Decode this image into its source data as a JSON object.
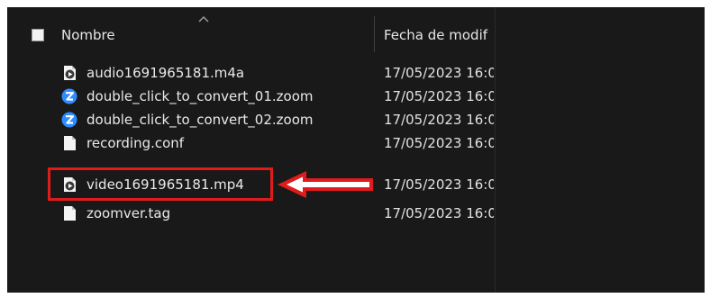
{
  "header": {
    "name_label": "Nombre",
    "date_label": "Fecha de modif",
    "sort_icon": "chevron-up-icon"
  },
  "files": [
    {
      "name": "audio1691965181.m4a",
      "date": "17/05/2023 16:0",
      "icon": "media-file-icon",
      "selected": false
    },
    {
      "name": "double_click_to_convert_01.zoom",
      "date": "17/05/2023 16:0",
      "icon": "zoom-file-icon",
      "selected": false
    },
    {
      "name": "double_click_to_convert_02.zoom",
      "date": "17/05/2023 16:0",
      "icon": "zoom-file-icon",
      "selected": false
    },
    {
      "name": "recording.conf",
      "date": "17/05/2023 16:0",
      "icon": "document-icon",
      "selected": false
    },
    {
      "name": "video1691965181.mp4",
      "date": "17/05/2023 16:0",
      "icon": "media-file-icon",
      "selected": false
    },
    {
      "name": "zoomver.tag",
      "date": "17/05/2023 16:0",
      "icon": "document-icon",
      "selected": false
    }
  ],
  "annotation": {
    "highlighted_file": "video1691965181.mp4",
    "box_color": "#e01b1b",
    "arrow_icon": "left-arrow-icon"
  },
  "colors": {
    "background": "#191919",
    "text": "#e9e9e9",
    "zoom_blue": "#2d8cff"
  }
}
